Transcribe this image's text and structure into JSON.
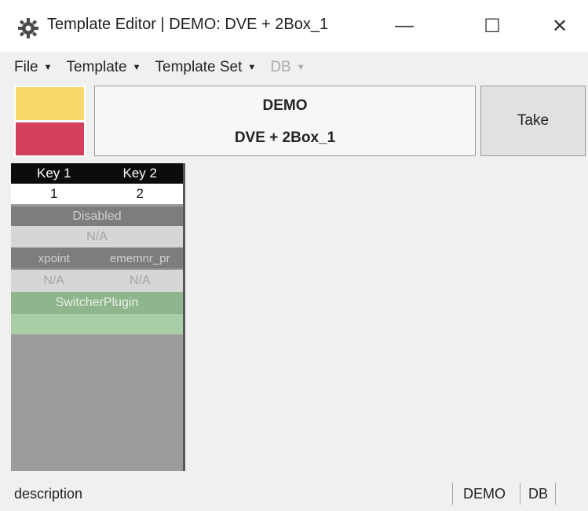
{
  "window": {
    "title": "Template Editor | DEMO: DVE + 2Box_1",
    "minimize_glyph": "—",
    "maximize_glyph": "☐",
    "close_glyph": "✕",
    "app_icon": "gear-icon"
  },
  "menu": {
    "items": [
      {
        "label": "File",
        "caret": "▼",
        "enabled": true
      },
      {
        "label": "Template",
        "caret": "▼",
        "enabled": true
      },
      {
        "label": "Template Set",
        "caret": "▼",
        "enabled": true
      },
      {
        "label": "DB",
        "caret": "▼",
        "enabled": false
      }
    ]
  },
  "header": {
    "colors": [
      "#f7d86a",
      "#d2405c"
    ],
    "name_line1": "DEMO",
    "name_line2": "DVE + 2Box_1",
    "take_label": "Take"
  },
  "keys": {
    "headers": [
      "Key 1",
      "Key 2"
    ],
    "values": [
      "1",
      "2"
    ],
    "state": "Disabled",
    "state_value": "N/A",
    "fields": [
      "xpoint",
      "ememnr_pr"
    ],
    "field_values": [
      "N/A",
      "N/A"
    ],
    "plugin": "SwitcherPlugin"
  },
  "status": {
    "description": "description",
    "demo": "DEMO",
    "db": "DB"
  }
}
